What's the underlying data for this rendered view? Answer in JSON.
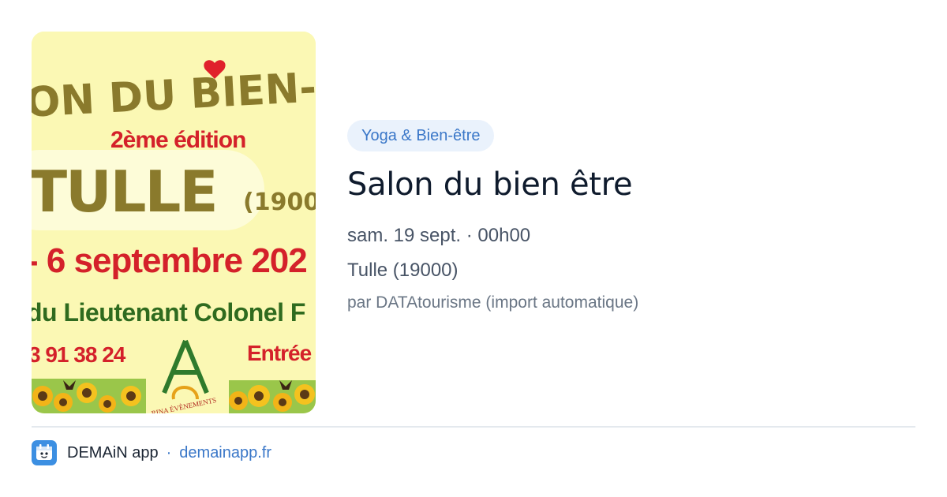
{
  "poster": {
    "line1": "ON DU BIEN-Ê",
    "line2": "2ème édition",
    "line3": "TULLE",
    "line3b": "(1900",
    "line4": "- 6 septembre 202",
    "line5": "du Lieutenant Colonel F",
    "line6a": "3 91 38 24",
    "line6b": "Entrée",
    "brand": "RINA ÉVÈNEMENTS",
    "colors": {
      "background": "#fbf8b4",
      "olive": "#8a7a2c",
      "red": "#d4212a",
      "green": "#2f7a2c"
    }
  },
  "event": {
    "category": "Yoga & Bien-être",
    "title": "Salon du bien être",
    "date": "sam. 19 sept. · 00h00",
    "location": "Tulle (19000)",
    "source": "par DATAtourisme (import automatique)"
  },
  "footer": {
    "app_icon": "demain-app-icon",
    "app_name": "DEMAiN app",
    "separator": "·",
    "domain": "demainapp.fr"
  }
}
